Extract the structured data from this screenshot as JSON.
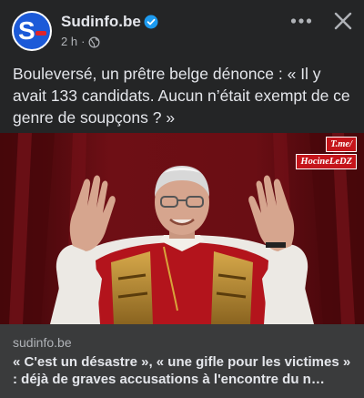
{
  "post": {
    "page_name": "Sudinfo.be",
    "time": "2 h",
    "separator": "·",
    "audience_icon": "globe-icon",
    "text": "Bouleversé, un prêtre belge dénonce : « Il y avait 133 candidats. Aucun n’était exempt de ce genre de soupçons ? »"
  },
  "header_actions": {
    "more_icon": "more-horizontal-icon",
    "close_icon": "close-icon"
  },
  "media": {
    "watermark_line1": "T.me/",
    "watermark_line2": "HocineLeDZ"
  },
  "link_preview": {
    "domain": "sudinfo.be",
    "title": "« C'est un désastre », « une gifle pour les victimes » : déjà de graves accusations à l'encontre du n…"
  },
  "colors": {
    "background": "#242526",
    "link_preview_bg": "#3a3b3c",
    "verified_blue": "#1d9bf0",
    "brand_blue": "#1c5ad8",
    "brand_red": "#e0232a"
  }
}
